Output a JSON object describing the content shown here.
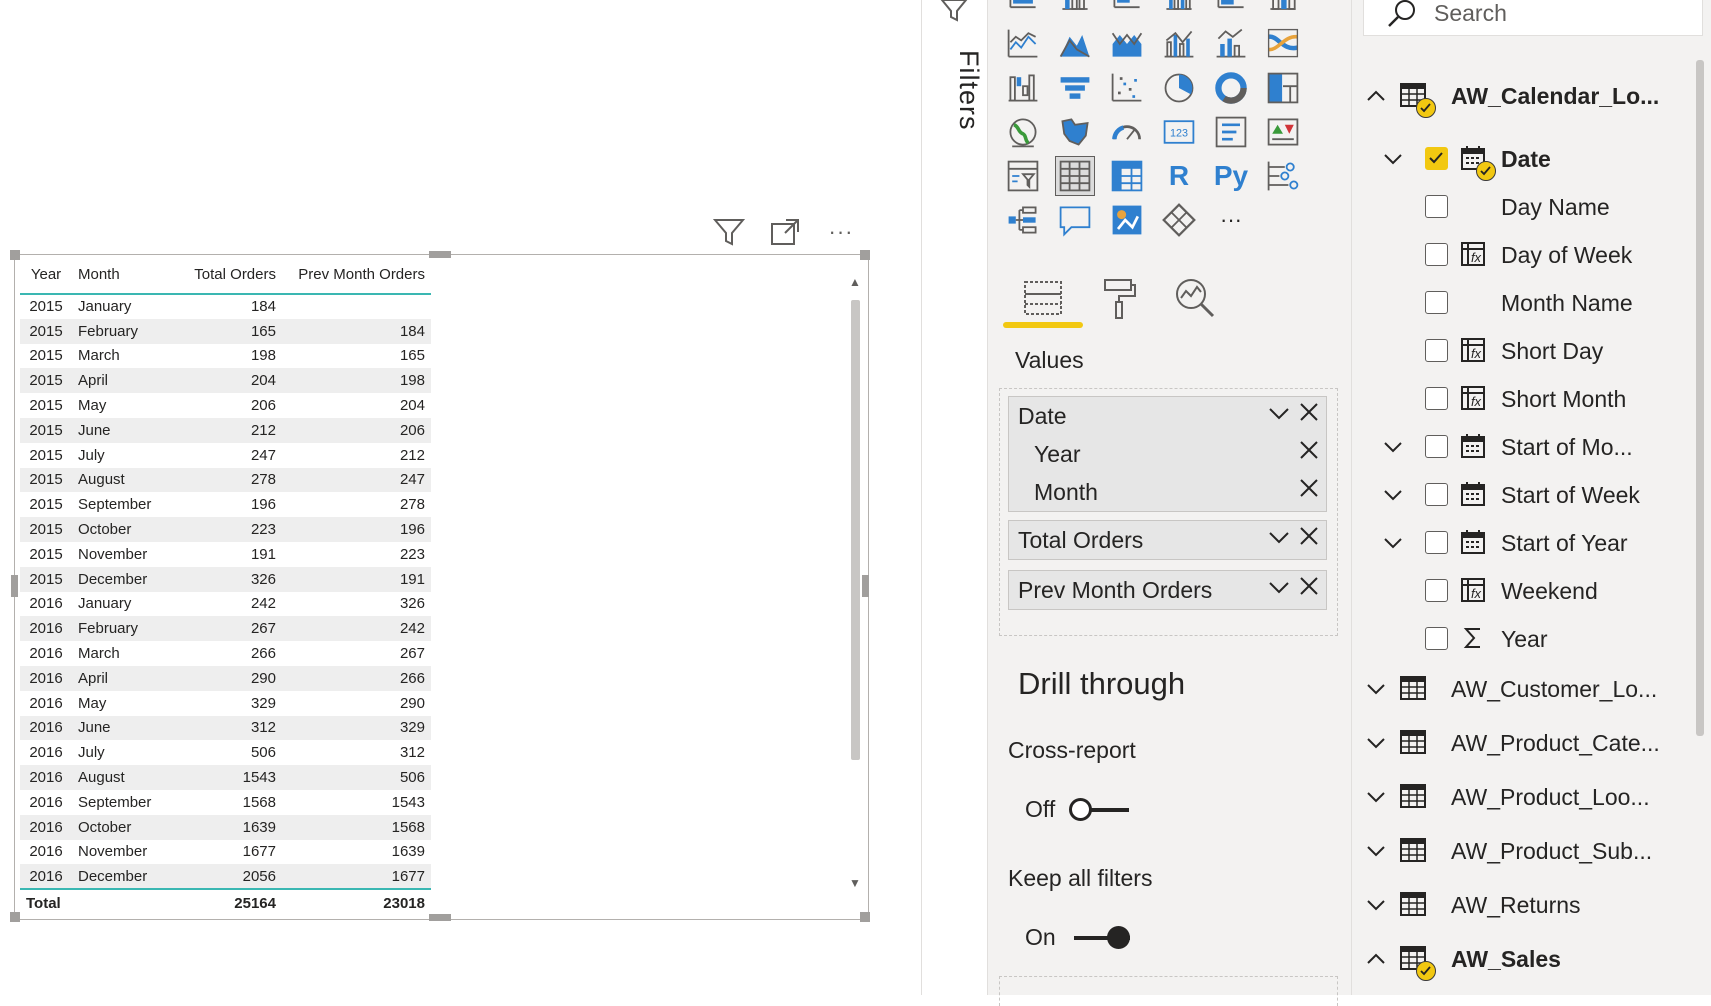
{
  "visual_header": {
    "filter_icon": "filter-icon",
    "focus_icon": "focus-mode-icon",
    "more_icon": "more-options-icon",
    "more_label": "···"
  },
  "matrix": {
    "columns": [
      "Year",
      "Month",
      "Total Orders",
      "Prev Month Orders"
    ],
    "rows": [
      [
        "2015",
        "January",
        "184",
        ""
      ],
      [
        "2015",
        "February",
        "165",
        "184"
      ],
      [
        "2015",
        "March",
        "198",
        "165"
      ],
      [
        "2015",
        "April",
        "204",
        "198"
      ],
      [
        "2015",
        "May",
        "206",
        "204"
      ],
      [
        "2015",
        "June",
        "212",
        "206"
      ],
      [
        "2015",
        "July",
        "247",
        "212"
      ],
      [
        "2015",
        "August",
        "278",
        "247"
      ],
      [
        "2015",
        "September",
        "196",
        "278"
      ],
      [
        "2015",
        "October",
        "223",
        "196"
      ],
      [
        "2015",
        "November",
        "191",
        "223"
      ],
      [
        "2015",
        "December",
        "326",
        "191"
      ],
      [
        "2016",
        "January",
        "242",
        "326"
      ],
      [
        "2016",
        "February",
        "267",
        "242"
      ],
      [
        "2016",
        "March",
        "266",
        "267"
      ],
      [
        "2016",
        "April",
        "290",
        "266"
      ],
      [
        "2016",
        "May",
        "329",
        "290"
      ],
      [
        "2016",
        "June",
        "312",
        "329"
      ],
      [
        "2016",
        "July",
        "506",
        "312"
      ],
      [
        "2016",
        "August",
        "1543",
        "506"
      ],
      [
        "2016",
        "September",
        "1568",
        "1543"
      ],
      [
        "2016",
        "October",
        "1639",
        "1568"
      ],
      [
        "2016",
        "November",
        "1677",
        "1639"
      ],
      [
        "2016",
        "December",
        "2056",
        "1677"
      ]
    ],
    "total": {
      "label": "Total",
      "total_orders": "25164",
      "prev_month_orders": "23018"
    }
  },
  "filters_pane": {
    "label": "Filters"
  },
  "visualizations": {
    "more_label": "···",
    "r_label": "R",
    "py_label": "Py",
    "card_label": "123",
    "values_label": "Values",
    "wells": {
      "date": {
        "label": "Date",
        "children": [
          "Year",
          "Month"
        ]
      },
      "total_orders": "Total Orders",
      "prev_month_orders": "Prev Month Orders"
    },
    "drill_through": {
      "title": "Drill through",
      "cross_report": "Cross-report",
      "cross_report_state": "Off",
      "keep_all_filters": "Keep all filters",
      "keep_all_filters_state": "On"
    }
  },
  "fields": {
    "search_placeholder": "Search",
    "tables": {
      "calendar": "AW_Calendar_Lo...",
      "customer": "AW_Customer_Lo...",
      "product_cate": "AW_Product_Cate...",
      "product_loo": "AW_Product_Loo...",
      "product_sub": "AW_Product_Sub...",
      "returns": "AW_Returns",
      "sales": "AW_Sales"
    },
    "calendar_fields": {
      "date": "Date",
      "day_name": "Day Name",
      "day_of_week": "Day of Week",
      "month_name": "Month Name",
      "short_day": "Short Day",
      "short_month": "Short Month",
      "start_of_month": "Start of Mo...",
      "start_of_week": "Start of Week",
      "start_of_year": "Start of Year",
      "weekend": "Weekend",
      "year": "Year"
    }
  },
  "colors": {
    "accent": "#f2c811",
    "table_rule": "#3ab7b2",
    "viz_blue": "#2f80cf",
    "text": "#252423"
  }
}
